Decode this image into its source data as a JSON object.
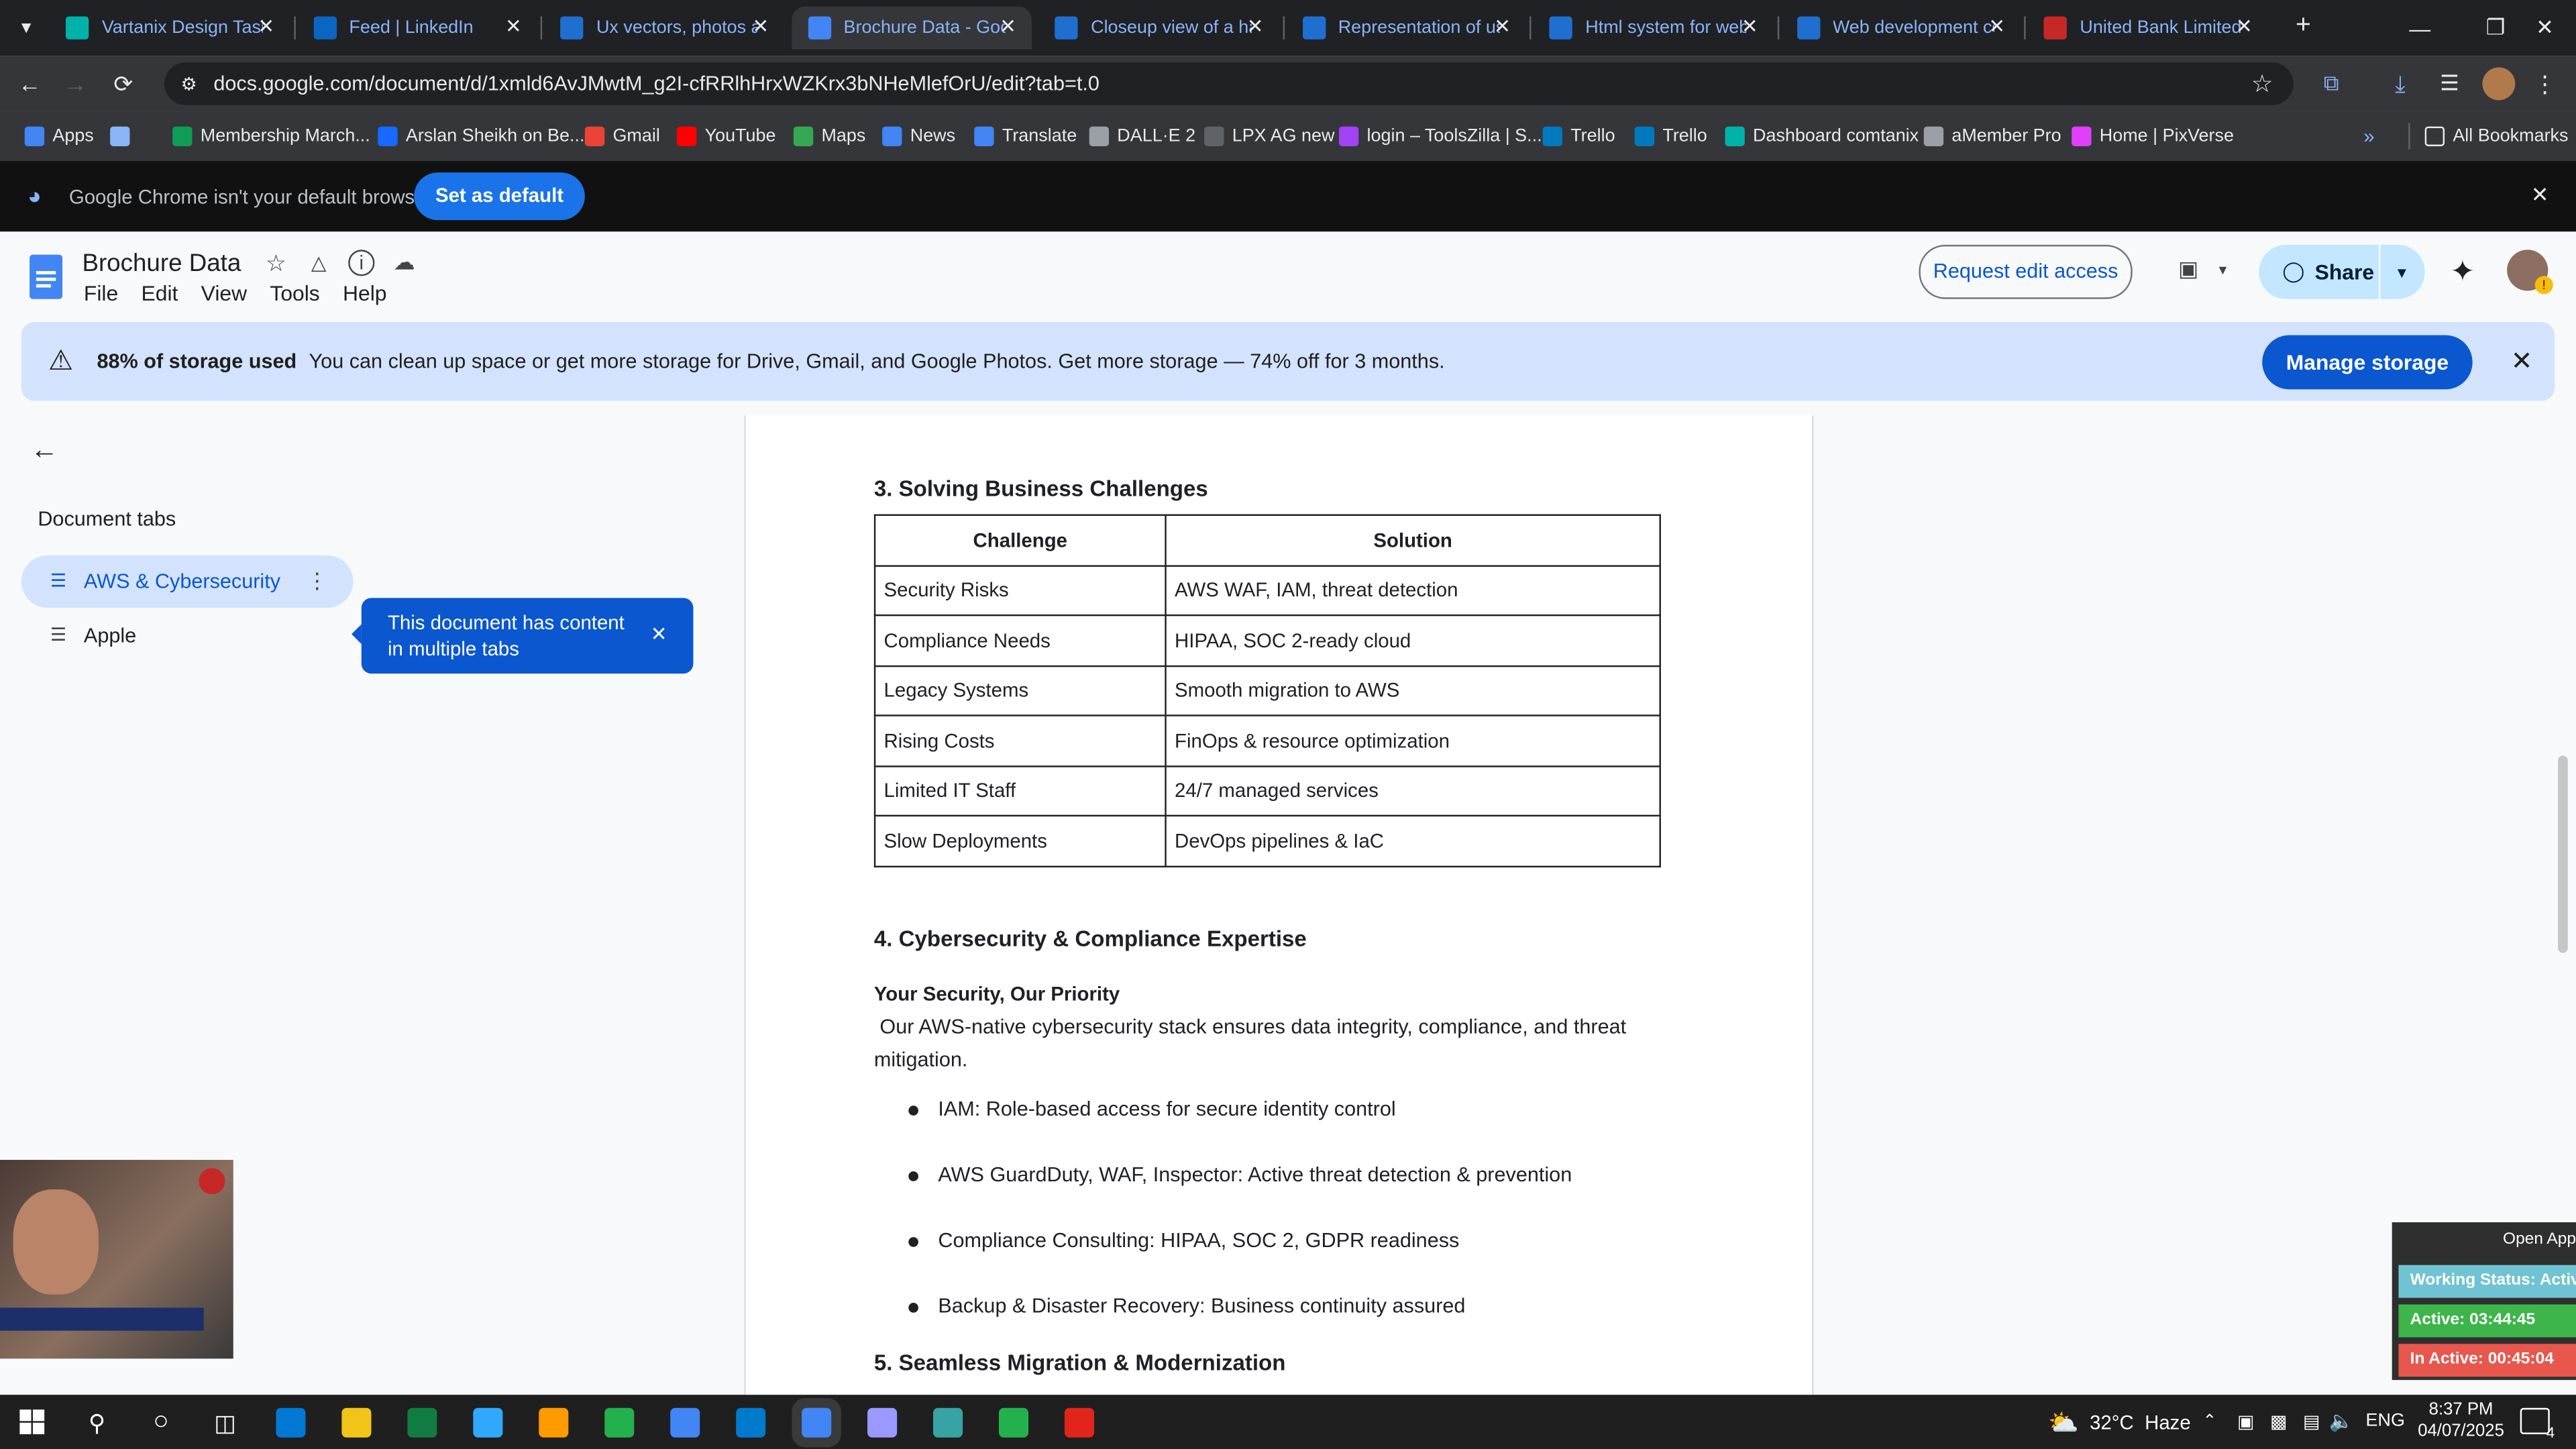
{
  "browser": {
    "tabs": [
      {
        "title": "Vartanix Design Tasks",
        "color": "#00b2a9",
        "active": false
      },
      {
        "title": "Feed | LinkedIn",
        "color": "#0a66c2",
        "active": false
      },
      {
        "title": "Ux vectors, photos an",
        "color": "#1f6fd1",
        "active": false
      },
      {
        "title": "Brochure Data - Goo",
        "color": "#4285f4",
        "active": true
      },
      {
        "title": "Closeup view of a ha",
        "color": "#1f6fd1",
        "active": false
      },
      {
        "title": "Representation of us",
        "color": "#1f6fd1",
        "active": false
      },
      {
        "title": "Html system for web",
        "color": "#1f6fd1",
        "active": false
      },
      {
        "title": "Web development co",
        "color": "#1f6fd1",
        "active": false
      },
      {
        "title": "United Bank Limited",
        "color": "#c62828",
        "active": false
      }
    ],
    "new_tab": "+",
    "url": "docs.google.com/document/d/1xmld6AvJMwtM_g2I-cfRRlhHrxWZKrx3bNHeMlefOrU/edit?tab=t.0",
    "bookmarks": [
      {
        "label": "Apps",
        "color": "#4285f4"
      },
      {
        "label": "",
        "color": "#8ab4f8"
      },
      {
        "label": "Membership March...",
        "color": "#0f9d58"
      },
      {
        "label": "Arslan Sheikh on Be...",
        "color": "#1769ff"
      },
      {
        "label": "Gmail",
        "color": "#ea4335"
      },
      {
        "label": "YouTube",
        "color": "#ff0000"
      },
      {
        "label": "Maps",
        "color": "#34a853"
      },
      {
        "label": "News",
        "color": "#4285f4"
      },
      {
        "label": "Translate",
        "color": "#4285f4"
      },
      {
        "label": "DALL·E 2",
        "color": "#9aa0a6"
      },
      {
        "label": "LPX AG new",
        "color": "#5f6368"
      },
      {
        "label": "login – ToolsZilla | S...",
        "color": "#a142f4"
      },
      {
        "label": "Trello",
        "color": "#0079bf"
      },
      {
        "label": "Trello",
        "color": "#0079bf"
      },
      {
        "label": "Dashboard comtanix",
        "color": "#00b2a9"
      },
      {
        "label": "aMember Pro",
        "color": "#9aa0a6"
      },
      {
        "label": "Home | PixVerse",
        "color": "#e040fb"
      }
    ],
    "all_bookmarks": "All Bookmarks",
    "default_notice": "Google Chrome isn't your default browser",
    "set_default": "Set as default"
  },
  "doc": {
    "title": "Brochure Data",
    "menu": [
      "File",
      "Edit",
      "View",
      "Tools",
      "Help"
    ],
    "request_edit": "Request edit access",
    "share": "Share"
  },
  "storage": {
    "bold": "88% of storage used",
    "text": "You can clean up space or get more storage for Drive, Gmail, and Google Photos. Get more storage — 74% off for 3 months.",
    "button": "Manage storage"
  },
  "sidebar": {
    "heading": "Document tabs",
    "tabs": [
      "AWS & Cybersecurity",
      "Apple"
    ],
    "tooltip": "This document has content in multiple tabs"
  },
  "content": {
    "section3": "3. Solving Business Challenges",
    "table_headers": [
      "Challenge",
      "Solution"
    ],
    "table_rows": [
      [
        "Security Risks",
        "AWS WAF, IAM, threat detection"
      ],
      [
        "Compliance Needs",
        "HIPAA, SOC 2-ready cloud"
      ],
      [
        "Legacy Systems",
        "Smooth migration to AWS"
      ],
      [
        "Rising Costs",
        "FinOps & resource optimization"
      ],
      [
        "Limited IT Staff",
        "24/7 managed services"
      ],
      [
        "Slow Deployments",
        "DevOps pipelines & IaC"
      ]
    ],
    "section4": "4. Cybersecurity & Compliance Expertise",
    "subtitle": "Your Security, Our Priority",
    "paragraph": " Our AWS-native cybersecurity stack ensures data integrity, compliance, and threat mitigation.",
    "bullets": [
      "IAM: Role-based access for secure identity control",
      "AWS GuardDuty, WAF, Inspector: Active threat detection & prevention",
      "Compliance Consulting: HIPAA, SOC 2, GDPR readiness",
      "Backup & Disaster Recovery: Business continuity assured"
    ],
    "section5": "5. Seamless Migration & Modernization"
  },
  "tracker": {
    "open": "Open App",
    "working": "Working Status: Active",
    "active": "Active: 03:44:45",
    "inactive": "In Active: 00:45:04"
  },
  "taskbar": {
    "weather": "32°C  Haze",
    "lang": "ENG",
    "time": "8:37 PM",
    "date": "04/07/2025",
    "notif": "4",
    "apps": [
      "#0078d4",
      "#f0c419",
      "#107c41",
      "#31a8ff",
      "#ff9a00",
      "#22b14c",
      "#4285f4",
      "#007acc",
      "#4285f4",
      "#9999ff",
      "#38a3a5",
      "#22b14c",
      "#e1251b"
    ]
  }
}
